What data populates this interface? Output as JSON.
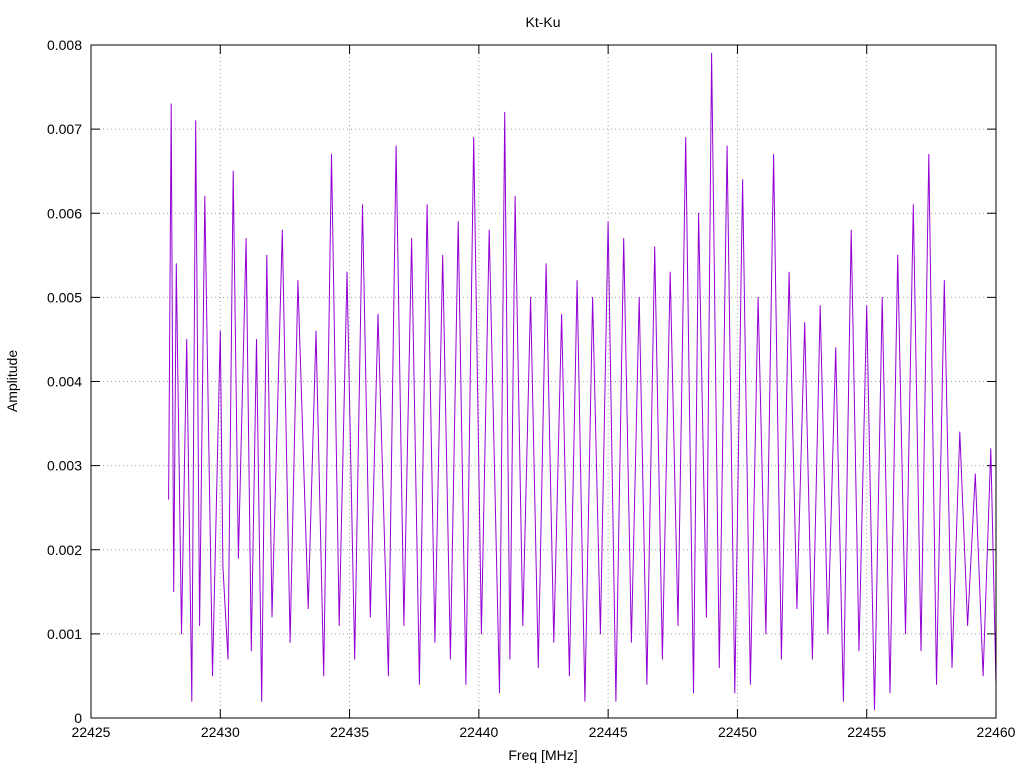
{
  "chart_data": {
    "type": "line",
    "title": "Kt-Ku",
    "xlabel": "Freq [MHz]",
    "ylabel": "Amplitude",
    "xlim": [
      22425,
      22460
    ],
    "ylim": [
      0,
      0.008
    ],
    "xticks": [
      22425,
      22430,
      22435,
      22440,
      22445,
      22450,
      22455,
      22460
    ],
    "xtick_labels": [
      "22425",
      "22430",
      "22435",
      "22440",
      "22445",
      "22450",
      "22455",
      "22460"
    ],
    "yticks": [
      0,
      0.001,
      0.002,
      0.003,
      0.004,
      0.005,
      0.006,
      0.007,
      0.008
    ],
    "ytick_labels": [
      "0",
      "0.001",
      "0.002",
      "0.003",
      "0.004",
      "0.005",
      "0.006",
      "0.007",
      "0.008"
    ],
    "grid": true,
    "legend": "none",
    "series_color": "#9400d3",
    "series": [
      {
        "x": [
          22428.0,
          22428.1,
          22428.2,
          22428.3,
          22428.5,
          22428.7,
          22428.9,
          22429.05,
          22429.2,
          22429.4,
          22429.7,
          22430.0,
          22430.1,
          22430.3,
          22430.5,
          22430.7,
          22431.0,
          22431.2,
          22431.4,
          22431.6,
          22431.8,
          22432.0,
          22432.4,
          22432.7,
          22433.0,
          22433.4,
          22433.7,
          22434.0,
          22434.3,
          22434.6,
          22434.9,
          22435.2,
          22435.5,
          22435.8,
          22436.1,
          22436.5,
          22436.8,
          22437.1,
          22437.4,
          22437.7,
          22438.0,
          22438.3,
          22438.6,
          22438.9,
          22439.2,
          22439.5,
          22439.8,
          22440.1,
          22440.4,
          22440.8,
          22441.0,
          22441.2,
          22441.4,
          22441.7,
          22442.0,
          22442.3,
          22442.6,
          22442.9,
          22443.2,
          22443.5,
          22443.8,
          22444.1,
          22444.4,
          22444.7,
          22445.0,
          22445.3,
          22445.6,
          22445.9,
          22446.2,
          22446.5,
          22446.8,
          22447.1,
          22447.4,
          22447.7,
          22448.0,
          22448.3,
          22448.5,
          22448.8,
          22449.0,
          22449.3,
          22449.6,
          22449.9,
          22450.2,
          22450.5,
          22450.8,
          22451.1,
          22451.4,
          22451.7,
          22452.0,
          22452.3,
          22452.6,
          22452.9,
          22453.2,
          22453.5,
          22453.8,
          22454.1,
          22454.4,
          22454.7,
          22455.0,
          22455.3,
          22455.6,
          22455.9,
          22456.2,
          22456.5,
          22456.8,
          22457.1,
          22457.4,
          22457.7,
          22458.0,
          22458.3,
          22458.6,
          22458.9,
          22459.2,
          22459.5,
          22459.8,
          22460.0
        ],
        "y": [
          0.0026,
          0.0073,
          0.0015,
          0.0054,
          0.001,
          0.0045,
          0.0002,
          0.0071,
          0.0011,
          0.0062,
          0.0005,
          0.0046,
          0.0018,
          0.0007,
          0.0065,
          0.0019,
          0.0057,
          0.0008,
          0.0045,
          0.0002,
          0.0055,
          0.0012,
          0.0058,
          0.0009,
          0.0052,
          0.0013,
          0.0046,
          0.0005,
          0.0067,
          0.0011,
          0.0053,
          0.0007,
          0.0061,
          0.0012,
          0.0048,
          0.0005,
          0.0068,
          0.0011,
          0.0057,
          0.0004,
          0.0061,
          0.0009,
          0.0055,
          0.0007,
          0.0059,
          0.0004,
          0.0069,
          0.001,
          0.0058,
          0.0003,
          0.0072,
          0.0007,
          0.0062,
          0.0011,
          0.005,
          0.0006,
          0.0054,
          0.0009,
          0.0048,
          0.0005,
          0.0052,
          0.0002,
          0.005,
          0.001,
          0.0059,
          0.0002,
          0.0057,
          0.0009,
          0.005,
          0.0004,
          0.0056,
          0.0007,
          0.0053,
          0.0011,
          0.0069,
          0.0003,
          0.006,
          0.0012,
          0.0079,
          0.0006,
          0.0068,
          0.0003,
          0.0064,
          0.0004,
          0.005,
          0.001,
          0.0067,
          0.0007,
          0.0053,
          0.0013,
          0.0047,
          0.0007,
          0.0049,
          0.001,
          0.0044,
          0.0002,
          0.0058,
          0.0008,
          0.0049,
          0.0001,
          0.005,
          0.0003,
          0.0055,
          0.001,
          0.0061,
          0.0008,
          0.0067,
          0.0004,
          0.0052,
          0.0006,
          0.0034,
          0.0011,
          0.0029,
          0.0005,
          0.0032,
          0.0004
        ]
      }
    ]
  }
}
